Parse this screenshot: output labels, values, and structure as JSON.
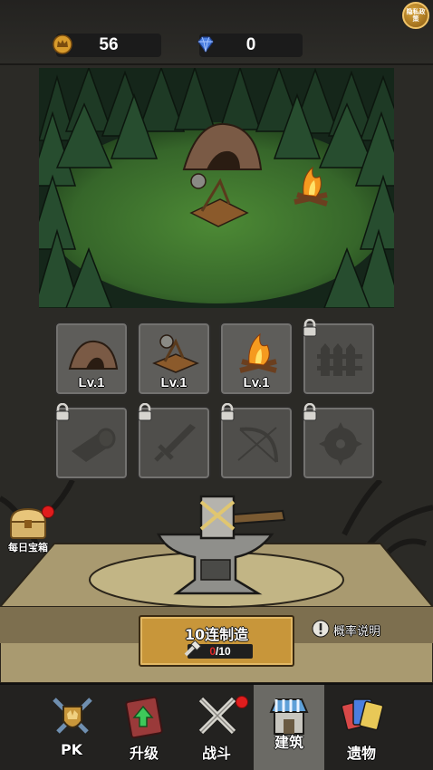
{
  "header": {
    "coins": "56",
    "gems": "0",
    "privacy_label": "隐私政策",
    "coin_icon": "crown-coin-icon",
    "gem_icon": "diamond-icon"
  },
  "buildings": [
    {
      "name": "cave",
      "level": "Lv.1",
      "locked": false
    },
    {
      "name": "catapult",
      "level": "Lv.1",
      "locked": false
    },
    {
      "name": "campfire",
      "level": "Lv.1",
      "locked": false
    },
    {
      "name": "fence",
      "level": "",
      "locked": true
    },
    {
      "name": "log",
      "level": "",
      "locked": true
    },
    {
      "name": "sword",
      "level": "",
      "locked": true
    },
    {
      "name": "bow",
      "level": "",
      "locked": true
    },
    {
      "name": "sawblade",
      "level": "",
      "locked": true
    }
  ],
  "daily_chest": {
    "label": "每日宝箱"
  },
  "forge": {
    "button_label": "10连制造",
    "cost_current": "0",
    "cost_total": "/10"
  },
  "probability": {
    "label": "概率说明"
  },
  "nav": {
    "pk": "PK",
    "upgrade": "升级",
    "battle": "战斗",
    "build": "建筑",
    "relics": "遗物"
  },
  "colors": {
    "accent_gold": "#c8963a",
    "grass": "#3d6b2c",
    "red_text": "#e02828"
  }
}
